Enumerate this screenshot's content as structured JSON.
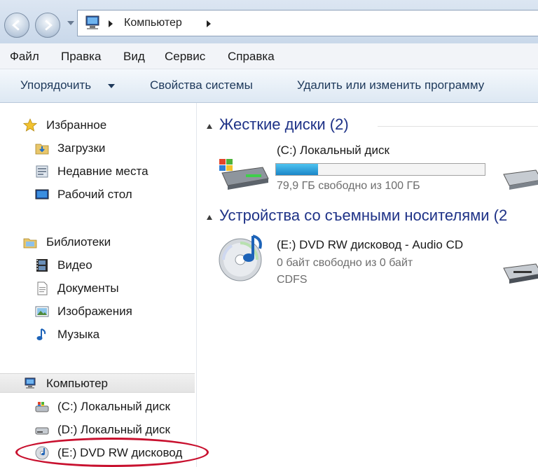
{
  "address_bar": {
    "location": "Компьютер",
    "icons": [
      "back-arrow-icon",
      "forward-arrow-icon",
      "computer-icon"
    ]
  },
  "menu": {
    "items": [
      "Файл",
      "Правка",
      "Вид",
      "Сервис",
      "Справка"
    ]
  },
  "toolbar": {
    "organize_label": "Упорядочить",
    "system_properties_label": "Свойства системы",
    "uninstall_label": "Удалить или изменить программу"
  },
  "sidebar": {
    "favorites": {
      "label": "Избранное",
      "icon": "star-icon",
      "items": [
        {
          "label": "Загрузки",
          "icon": "downloads-folder-icon"
        },
        {
          "label": "Недавние места",
          "icon": "recent-places-icon"
        },
        {
          "label": "Рабочий стол",
          "icon": "desktop-icon"
        }
      ]
    },
    "libraries": {
      "label": "Библиотеки",
      "icon": "library-folder-icon",
      "items": [
        {
          "label": "Видео",
          "icon": "video-icon"
        },
        {
          "label": "Документы",
          "icon": "documents-icon"
        },
        {
          "label": "Изображения",
          "icon": "pictures-icon"
        },
        {
          "label": "Музыка",
          "icon": "music-icon"
        }
      ]
    },
    "computer": {
      "label": "Компьютер",
      "icon": "computer-icon",
      "items": [
        {
          "label": "(C:) Локальный диск",
          "icon": "system-drive-icon"
        },
        {
          "label": "(D:) Локальный диск",
          "icon": "hard-drive-icon"
        },
        {
          "label": "(E:) DVD RW дисковод",
          "icon": "dvd-audio-icon"
        }
      ]
    }
  },
  "content": {
    "hard_disks": {
      "title": "Жесткие диски (2)",
      "drives": [
        {
          "name": "(C:) Локальный диск",
          "free_text": "79,9 ГБ свободно из 100 ГБ",
          "used_fraction": 0.201,
          "icon": "system-drive-icon"
        }
      ]
    },
    "removable": {
      "title": "Устройства со съемными носителями (2",
      "devices": [
        {
          "name": "(E:) DVD RW дисковод - Audio CD",
          "free_text": "0 байт свободно из 0 байт",
          "filesystem": "CDFS",
          "icon": "dvd-audio-icon"
        }
      ]
    }
  },
  "colors": {
    "section_title": "#1e3287",
    "toolbar_text": "#1e395b",
    "capacity_fill": "#2ea3e0",
    "highlight": "#c8102e"
  }
}
